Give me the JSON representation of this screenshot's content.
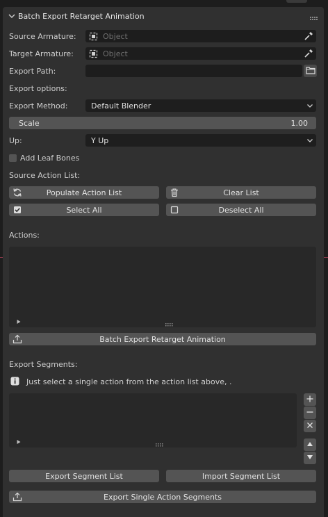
{
  "panel": {
    "title": "Batch Export Retarget Animation"
  },
  "source_armature": {
    "label": "Source Armature:",
    "placeholder": "Object"
  },
  "target_armature": {
    "label": "Target Armature:",
    "placeholder": "Object"
  },
  "export_path": {
    "label": "Export Path:",
    "value": ""
  },
  "export_options": {
    "label": "Export options:"
  },
  "export_method": {
    "label": "Export Method:",
    "value": "Default Blender"
  },
  "scale": {
    "label": "Scale",
    "value": "1.00"
  },
  "up": {
    "label": "Up:",
    "value": "Y Up"
  },
  "add_leaf_bones": {
    "label": "Add Leaf Bones",
    "checked": false
  },
  "source_action_list": {
    "label": "Source Action List:",
    "populate": "Populate Action List",
    "clear": "Clear List",
    "select_all": "Select All",
    "deselect_all": "Deselect All"
  },
  "actions": {
    "label": "Actions:"
  },
  "batch_export_button": "Batch Export Retarget Animation",
  "export_segments": {
    "label": "Export Segments:",
    "info": "Just select a single action from the action list above, .",
    "export_list": "Export Segment List",
    "import_list": "Import Segment List",
    "export_single": "Export Single Action Segments"
  },
  "colors": {
    "panel_bg": "#303030",
    "field_bg": "#1d1d1d",
    "button_bg": "#545454",
    "text": "#d6d6d6"
  }
}
